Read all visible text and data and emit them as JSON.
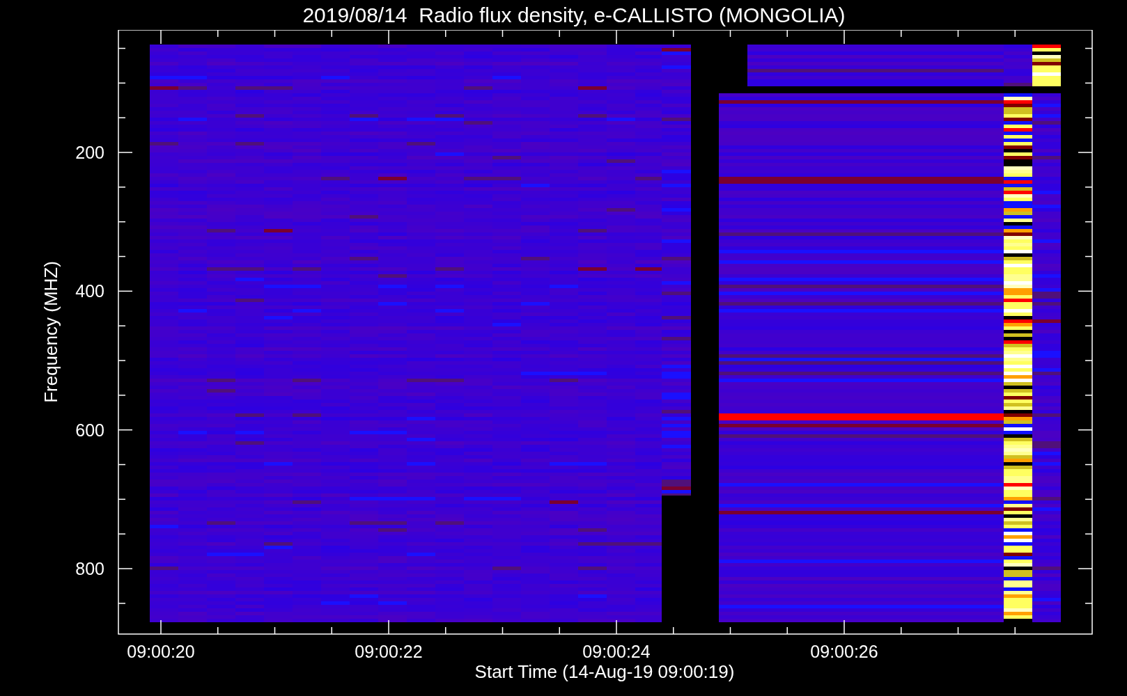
{
  "title": "2019/08/14  Radio flux density, e-CALLISTO (MONGOLIA)",
  "chart": {
    "ylabel": "Frequency (MHZ)",
    "xlabel": "Start Time (14-Aug-19 09:00:19)",
    "yticks": [
      "200",
      "400",
      "600",
      "800"
    ],
    "xticks": [
      "09:00:20",
      "09:00:22",
      "09:00:24",
      "09:00:26"
    ]
  }
}
